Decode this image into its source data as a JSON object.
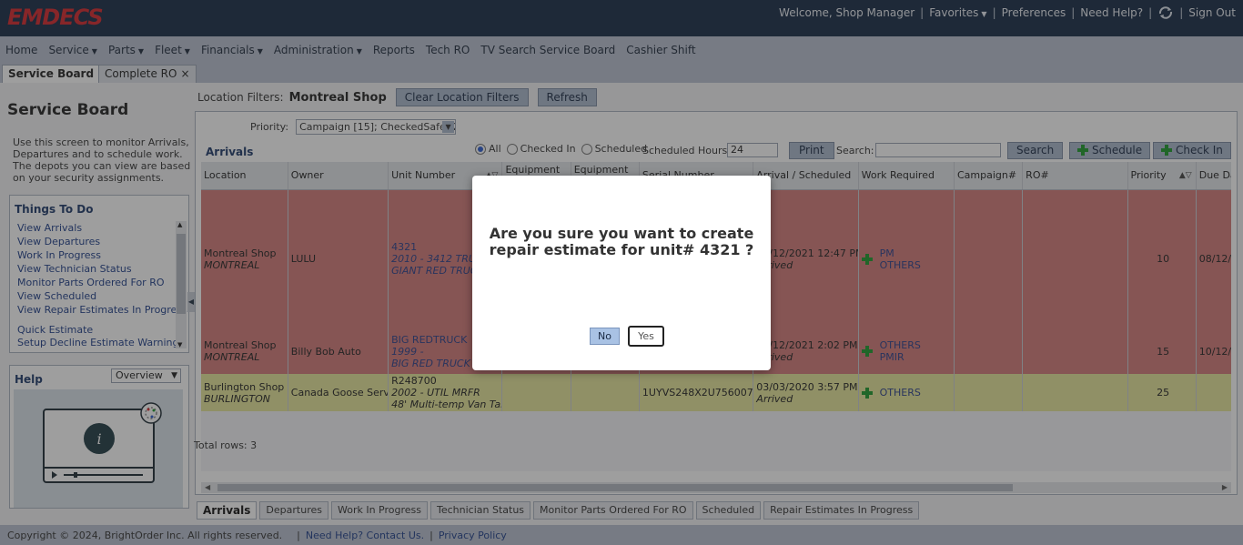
{
  "app": {
    "logo": "EMDECS"
  },
  "top_links": {
    "welcome": "Welcome, Shop Manager",
    "favorites": "Favorites",
    "preferences": "Preferences",
    "need_help": "Need Help?",
    "sign_out": "Sign Out"
  },
  "menu": [
    {
      "label": "Home"
    },
    {
      "label": "Service",
      "dropdown": true
    },
    {
      "label": "Parts",
      "dropdown": true
    },
    {
      "label": "Fleet",
      "dropdown": true
    },
    {
      "label": "Financials",
      "dropdown": true
    },
    {
      "label": "Administration",
      "dropdown": true
    },
    {
      "label": "Reports"
    },
    {
      "label": "Tech RO"
    },
    {
      "label": "TV Search Service Board"
    },
    {
      "label": "Cashier Shift"
    }
  ],
  "page_tabs": [
    {
      "label": "Service Board",
      "close": "×"
    },
    {
      "label": "Complete RO",
      "close": "×"
    }
  ],
  "left": {
    "title": "Service Board",
    "description": "Use this screen to monitor Arrivals, Departures and to schedule work. The depots you can view are based on your security assignments.",
    "things_to_do_title": "Things To Do",
    "things_to_do": [
      "View Arrivals",
      "View Departures",
      "Work In Progress",
      "View Technician Status",
      "Monitor Parts Ordered For RO",
      "View Scheduled",
      "View Repair Estimates In Progress"
    ],
    "things_to_do_extra": [
      "Quick Estimate",
      "Setup Decline Estimate Warning"
    ],
    "help_title": "Help",
    "help_select": "Overview",
    "help_icon_letter": "i"
  },
  "filters": {
    "location_label": "Location Filters:",
    "location_value": "Montreal Shop",
    "clear_button": "Clear Location Filters",
    "refresh_button": "Refresh"
  },
  "toolbar": {
    "priority_label": "Priority:",
    "priority_value": "Campaign [15]; CheckedSafe [2",
    "section_title": "Arrivals",
    "radio_all": "All",
    "radio_checked_in": "Checked In",
    "radio_scheduled": "Scheduled",
    "radio_selected": "All",
    "scheduled_hours_label": "Scheduled Hours:",
    "scheduled_hours_value": "24",
    "print_button": "Print",
    "search_label": "Search:",
    "search_value": "",
    "search_button": "Search",
    "schedule_button": "Schedule",
    "check_in_button": "Check In"
  },
  "table": {
    "columns": [
      "Location",
      "Owner",
      "Unit Number",
      "Equipment",
      "Equipment",
      "Serial Number",
      "Arrival / Scheduled",
      "Work Required",
      "Campaign#",
      "RO#",
      "Priority",
      "Due Dat"
    ],
    "rows": [
      {
        "location": "Montreal Shop",
        "location_sub": "MONTREAL",
        "owner": "LULU",
        "unit": "4321",
        "unit_line2": "2010 - 3412 TRUCK",
        "unit_line3": "GIANT RED TRUCK",
        "serial": "",
        "arrival": "12/12/2021 12:47 PM",
        "arrival_status": "Arrived",
        "work": [
          "PM",
          "OTHERS"
        ],
        "campaign": "",
        "ro": "",
        "priority": "10",
        "due": "08/12/2"
      },
      {
        "location": "Montreal Shop",
        "location_sub": "MONTREAL",
        "owner": "Billy Bob Auto",
        "unit": "BIG REDTRUCK",
        "unit_line2": "1999 -",
        "unit_line3": "BIG RED TRUCK",
        "serial": "",
        "arrival": "12/12/2021 2:02 PM",
        "arrival_status": "Arrived",
        "work": [
          "OTHERS",
          "PMIR"
        ],
        "campaign": "",
        "ro": "",
        "priority": "15",
        "due": "10/12/2"
      },
      {
        "location": "Burlington Shop",
        "location_sub": "BURLINGTON",
        "owner": "Canada Goose Serv...",
        "unit": "R248700",
        "unit_line2": "2002 - UTIL MRFR",
        "unit_line3": "48' Multi-temp Van Tande",
        "serial": "1UYVS248X2U756007",
        "arrival": "03/03/2020 3:57 PM",
        "arrival_status": "Arrived",
        "work": [
          "OTHERS"
        ],
        "campaign": "",
        "ro": "",
        "priority": "25",
        "due": ""
      }
    ],
    "total_rows_label": "Total rows:",
    "total_rows": "3"
  },
  "bottom_tabs": [
    "Arrivals",
    "Departures",
    "Work In Progress",
    "Technician Status",
    "Monitor Parts Ordered For RO",
    "Scheduled",
    "Repair Estimates In Progress"
  ],
  "footer": {
    "copyright": "Copyright © 2024, BrightOrder Inc. All rights reserved.",
    "help_link": "Need Help? Contact Us.",
    "privacy_link": "Privacy Policy"
  },
  "dialog": {
    "message": "Are you sure you want to create repair estimate for unit# 4321 ?",
    "no": "No",
    "yes": "Yes"
  },
  "colors": {
    "topbar": "#162a45",
    "logo": "#d6252a",
    "row_red": "#d47b78",
    "row_yellow": "#e5e59a",
    "add_green": "#1c9a2b"
  },
  "icons": [
    "sync-icon",
    "close-icon",
    "scroll-up-icon",
    "scroll-down-icon",
    "collapse-left-icon",
    "add-icon",
    "sort-asc-icon",
    "filter-icon",
    "video-player-icon",
    "info-icon",
    "chevron-down-icon"
  ]
}
